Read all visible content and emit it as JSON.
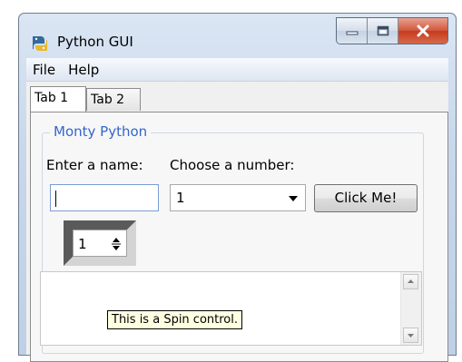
{
  "window": {
    "title": "Python GUI",
    "icon": "python-logo-icon",
    "caption_buttons": [
      "minimize-icon",
      "maximize-icon",
      "close-icon"
    ]
  },
  "menu": {
    "items": [
      {
        "label": "File"
      },
      {
        "label": "Help"
      }
    ]
  },
  "tabs": [
    {
      "label": "Tab 1",
      "selected": true
    },
    {
      "label": "Tab 2",
      "selected": false
    }
  ],
  "group": {
    "title": "Monty Python",
    "name_label": "Enter a name:",
    "name_value": "",
    "number_label": "Choose a number:",
    "number_value": "1",
    "button_label": "Click Me!",
    "spin_value": "1"
  },
  "tooltip": {
    "text": "This is a Spin control."
  },
  "colors": {
    "group_title": "#3366cc",
    "close_button": "#c63a1e"
  }
}
